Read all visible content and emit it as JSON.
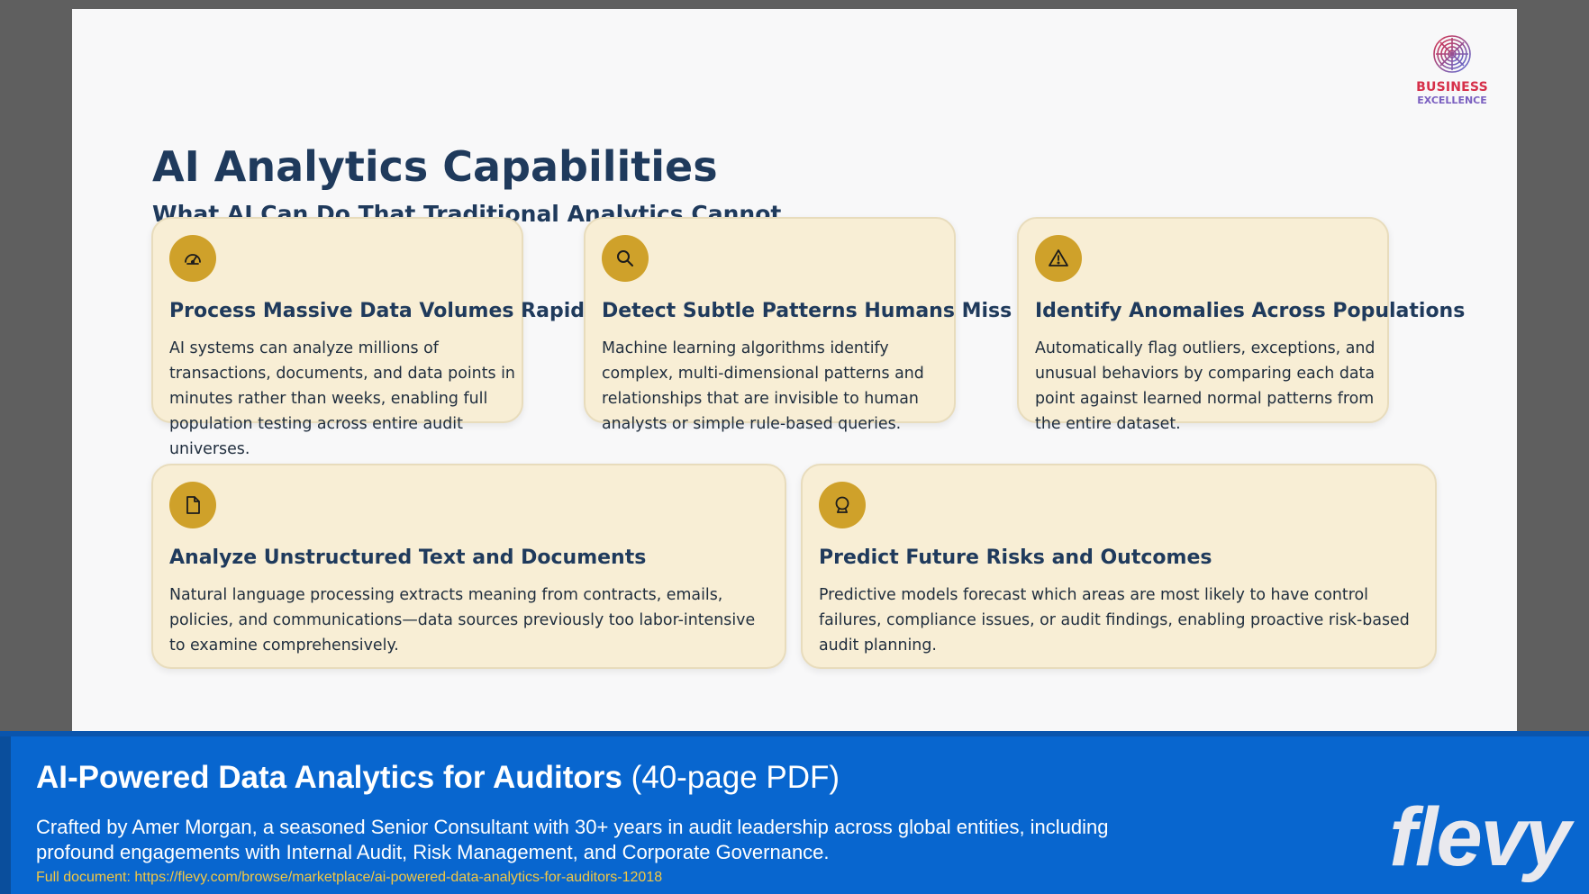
{
  "slide": {
    "logo": {
      "line1": "BUSINESS",
      "line2": "EXCELLENCE"
    },
    "title": "AI Analytics Capabilities",
    "subtitle": "What AI Can Do That Traditional Analytics Cannot",
    "cards": [
      {
        "icon": "speedometer-icon",
        "title": "Process Massive Data Volumes Rapidly",
        "body": "AI systems can analyze millions of transactions, documents, and data points in minutes rather than weeks, enabling full population testing across entire audit universes."
      },
      {
        "icon": "search-icon",
        "title": "Detect Subtle Patterns Humans Miss",
        "body": "Machine learning algorithms identify complex, multi-dimensional patterns and relationships that are invisible to human analysts or simple rule-based queries."
      },
      {
        "icon": "warning-icon",
        "title": "Identify Anomalies Across Populations",
        "body": "Automatically flag outliers, exceptions, and unusual behaviors by comparing each data point against learned normal patterns from the entire dataset."
      },
      {
        "icon": "document-icon",
        "title": "Analyze Unstructured Text and Documents",
        "body": "Natural language processing extracts meaning from contracts, emails, policies, and communications—data sources previously too labor-intensive to examine comprehensively."
      },
      {
        "icon": "crystal-ball-icon",
        "title": "Predict Future Risks and Outcomes",
        "body": "Predictive models forecast which areas are most likely to have control failures, compliance issues, or audit findings, enabling proactive risk-based audit planning."
      }
    ]
  },
  "banner": {
    "title_strong": "AI-Powered Data Analytics for Auditors",
    "title_light": "(40-page PDF)",
    "description": "Crafted by Amer Morgan, a seasoned Senior Consultant with 30+ years in audit leadership across global entities, including profound engagements with Internal Audit, Risk Management, and Corporate Governance.",
    "link": "Full document: https://flevy.com/browse/marketplace/ai-powered-data-analytics-for-auditors-12018",
    "brand": "flevy"
  },
  "colors": {
    "title": "#1f3a5c",
    "card_bg": "#f8eed5",
    "icon_circle": "#cfa12a",
    "banner_bg": "#0866cf",
    "link": "#f2c744"
  }
}
